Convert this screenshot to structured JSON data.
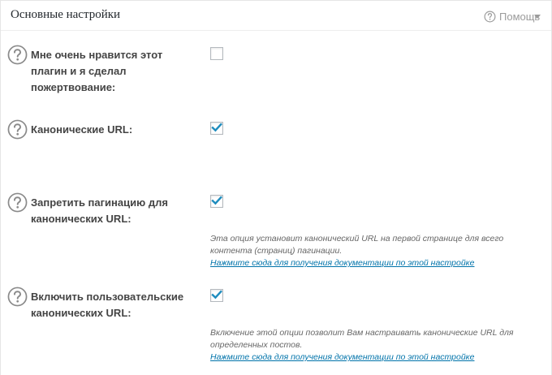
{
  "header": {
    "title": "Основные настройки",
    "help_label": "Помощь",
    "help_icon": "question-circle-icon",
    "toggle_icon": "caret-down-icon"
  },
  "settings": [
    {
      "label": "Мне очень нравится этот плагин и я сделал пожертвование:",
      "checked": false,
      "description": "",
      "doc_link": ""
    },
    {
      "label": "Канонические URL:",
      "checked": true,
      "description": "",
      "doc_link": ""
    },
    {
      "label": "Запретить пагинацию для канонических URL:",
      "checked": true,
      "description": "Эта опция установит канонический URL на первой странице для всего контента (страниц) пагинации.",
      "doc_link": "Нажмите сюда для получения документации по этой настройке"
    },
    {
      "label": "Включить пользовательские канонических URL:",
      "checked": true,
      "description": "Включение этой опции позволит Вам настраивать канонические URL для определенных постов.",
      "doc_link": "Нажмите сюда для получения документации по этой настройке"
    }
  ],
  "colors": {
    "checkmark": "#1e8cbe",
    "link": "#0073aa",
    "help_icon": "#9b9b9b"
  }
}
